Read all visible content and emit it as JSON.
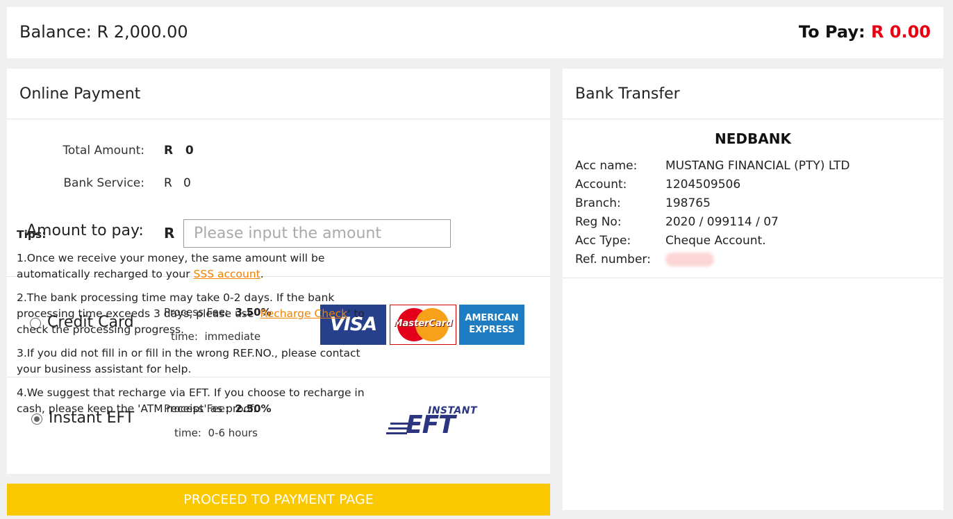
{
  "header": {
    "balance_label": "Balance:",
    "balance_value": "R 2,000.00",
    "topay_label": "To Pay:",
    "topay_value": "R 0.00"
  },
  "online": {
    "title": "Online Payment",
    "total_label": "Total Amount:",
    "total_currency": "R",
    "total_value": "0",
    "service_label": "Bank Service:",
    "service_currency": "R",
    "service_value": "0",
    "amount_label": "Amount to pay:",
    "amount_currency": "R",
    "amount_placeholder": "Please input the amount",
    "methods": [
      {
        "label": "Credit Card",
        "selected": false,
        "fee_label": "Process Fee:",
        "fee_value": "3.50%",
        "time_label": "time:",
        "time_value": "immediate",
        "logos": [
          "VISA",
          "MasterCard",
          "AMERICAN",
          "EXPRESS"
        ]
      },
      {
        "label": "Instant EFT",
        "selected": true,
        "fee_label": "Process Fee:",
        "fee_value": "2.50%",
        "time_label": "time:",
        "time_value": "0-6 hours",
        "logos": [
          "INSTANT",
          "EFT"
        ]
      }
    ],
    "proceed_label": "PROCEED TO PAYMENT PAGE"
  },
  "bank": {
    "title": "Bank Transfer",
    "bank_name": "NEDBANK",
    "rows": [
      {
        "key": "Acc name:",
        "value": "MUSTANG FINANCIAL (PTY) LTD"
      },
      {
        "key": "Account:",
        "value": "1204509506"
      },
      {
        "key": "Branch:",
        "value": "198765"
      },
      {
        "key": "Reg No:",
        "value": "2020 / 099114 / 07"
      },
      {
        "key": "Acc Type:",
        "value": "Cheque Account."
      },
      {
        "key": "Ref. number:",
        "value": ""
      }
    ]
  },
  "tips": {
    "title": "Tips:",
    "t1_a": "1.Once we receive your money, the same amount will be automatically recharged to your ",
    "t1_link": "SSS account",
    "t1_b": ".",
    "t2_a": "2.The bank processing time may take 0-2 days. If the bank processing time exceeds 3 days, please use '",
    "t2_link": "Recharge Check",
    "t2_b": "' to check the processing progress.",
    "t3": "3.If you did not fill in or fill in the wrong REF.NO., please contact your business assistant for help.",
    "t4": "4.We suggest that recharge via EFT. If you choose to recharge in cash, please keep the 'ATM receipt' as proof."
  },
  "colors": {
    "accent_red": "#e60012",
    "proceed_yellow": "#fbc800",
    "link_orange": "#f08200"
  }
}
